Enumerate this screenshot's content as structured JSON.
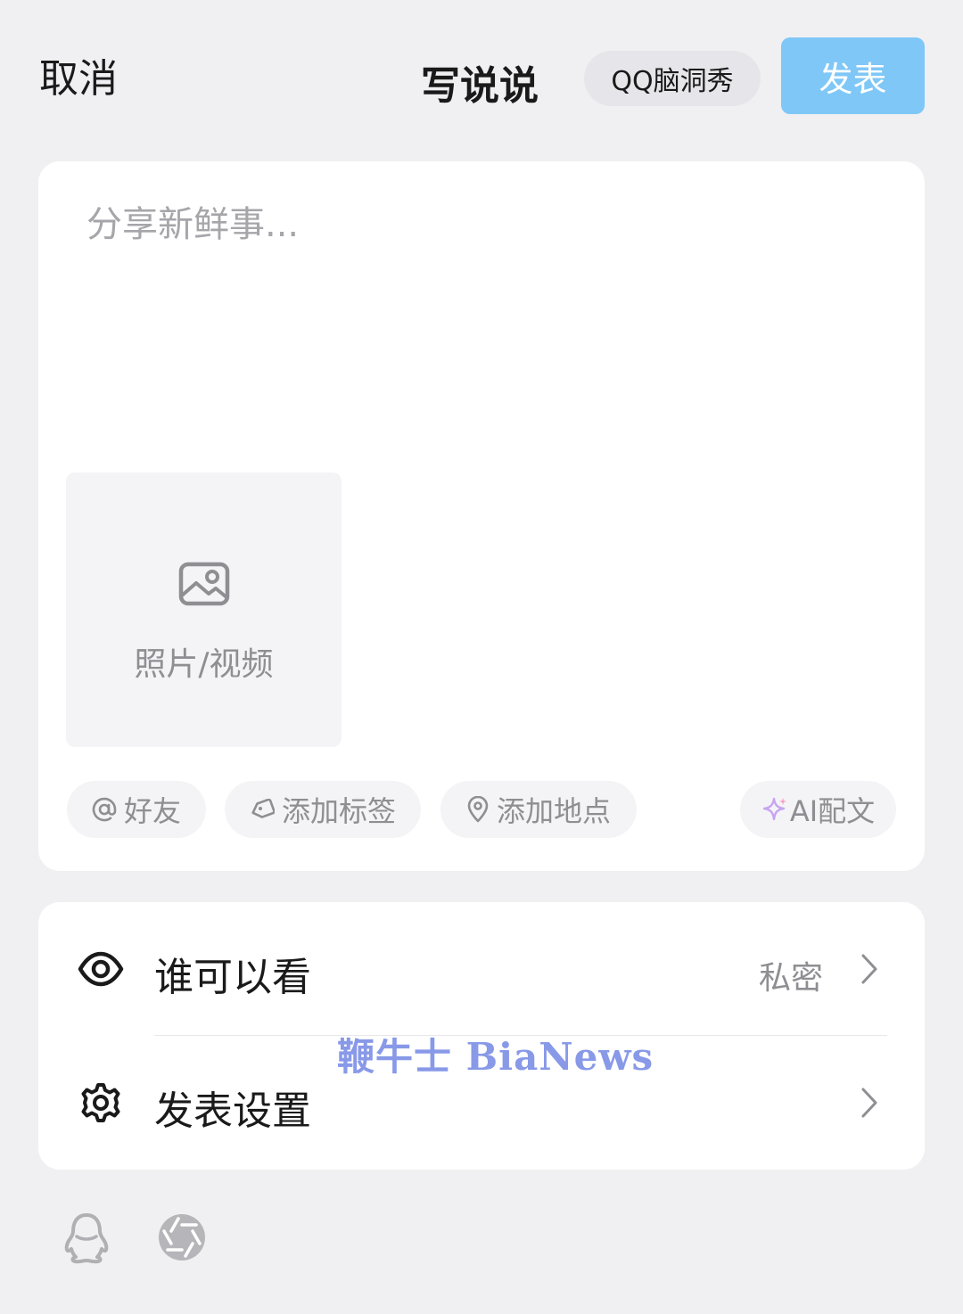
{
  "header": {
    "cancel_label": "取消",
    "title": "写说说",
    "brain_show_label": "QQ脑洞秀",
    "publish_label": "发表"
  },
  "compose": {
    "placeholder": "分享新鲜事...",
    "value": "",
    "media_label": "照片/视频"
  },
  "chips": {
    "friend_label": "好友",
    "tag_label": "添加标签",
    "place_label": "添加地点",
    "ai_label": "AI配文"
  },
  "settings": {
    "visibility_label": "谁可以看",
    "visibility_value": "私密",
    "publish_settings_label": "发表设置"
  },
  "watermark": "鞭牛士 BiaNews",
  "colors": {
    "background": "#f0f0f2",
    "card": "#ffffff",
    "publish_button": "#7fc7f7",
    "muted_text": "#8e8e93",
    "ai_icon": "#c7a4f2",
    "watermark": "#7c8fe6"
  },
  "icons": {
    "media": "image-icon",
    "friend": "at-icon",
    "tag": "tag-icon",
    "place": "location-pin-icon",
    "ai": "sparkle-icon",
    "visibility": "eye-icon",
    "settings": "gear-icon",
    "chevron": "chevron-right-icon",
    "qq": "qq-penguin-icon",
    "album": "shutter-icon"
  }
}
